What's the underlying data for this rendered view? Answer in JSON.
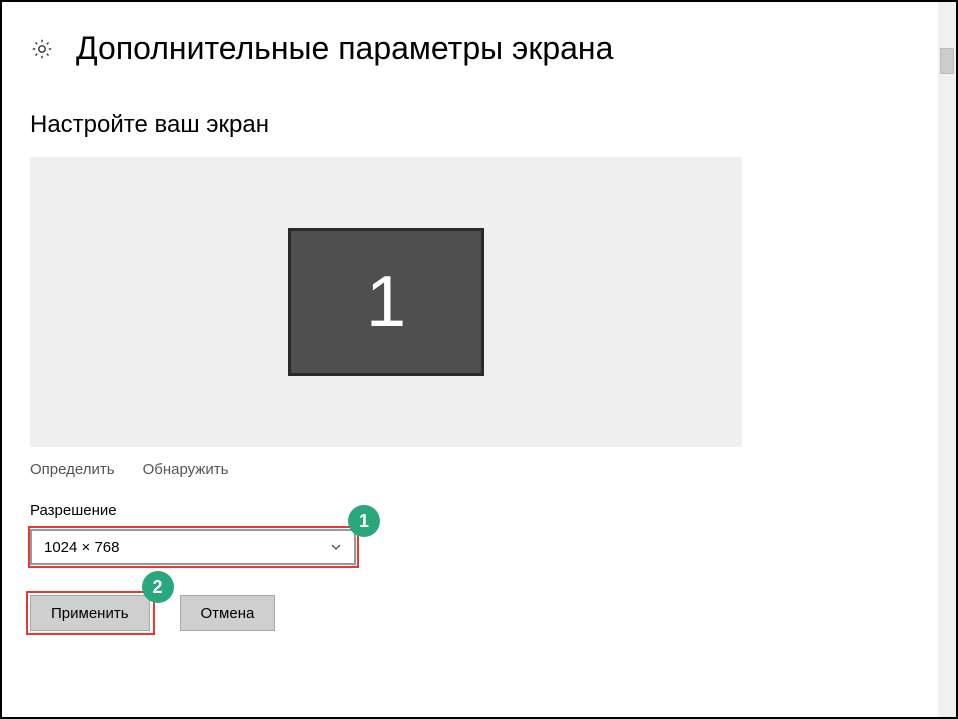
{
  "header": {
    "title": "Дополнительные параметры экрана"
  },
  "section": {
    "customize_title": "Настройте ваш экран",
    "monitor_number": "1"
  },
  "links": {
    "identify": "Определить",
    "detect": "Обнаружить"
  },
  "resolution": {
    "label": "Разрешение",
    "value": "1024 × 768"
  },
  "buttons": {
    "apply": "Применить",
    "cancel": "Отмена"
  },
  "annotations": {
    "badge1": "1",
    "badge2": "2"
  }
}
